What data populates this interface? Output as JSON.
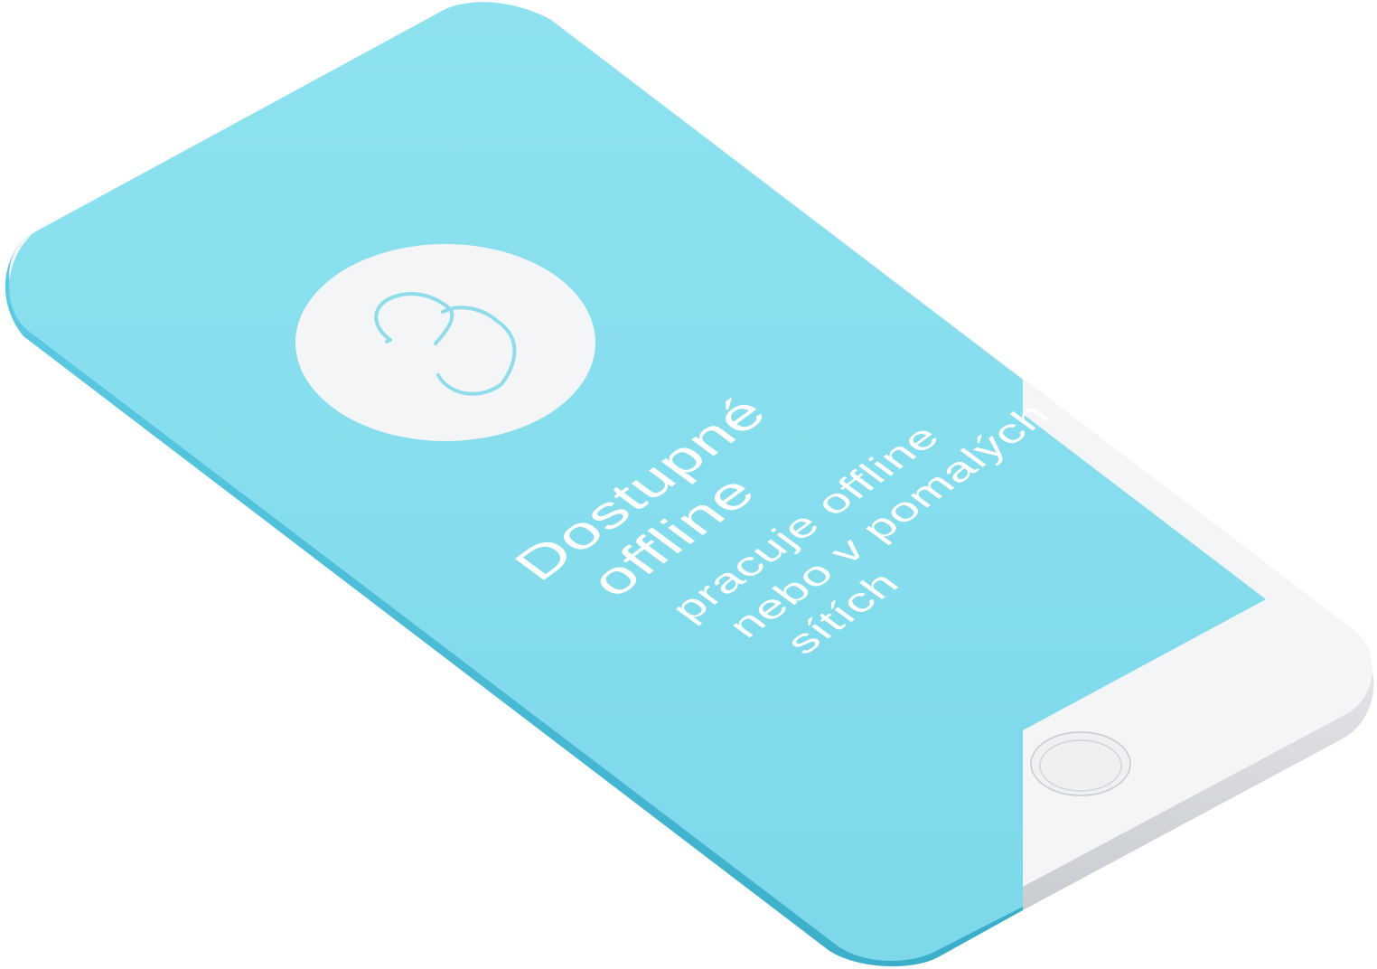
{
  "screen": {
    "title_line1": "Dostupné",
    "title_line2": "offline",
    "body_line1": "pracuje offline",
    "body_line2": "nebo v pomalých",
    "body_line3": "sítích",
    "feature_icon": "offline-sync-icon",
    "background_color": "#87dfee",
    "accent_color": "#8fdcea"
  },
  "device": {
    "body_color": "#f4f5f7",
    "edge_color": "#3cb6d2",
    "home_button_icon": "home-button-icon"
  }
}
